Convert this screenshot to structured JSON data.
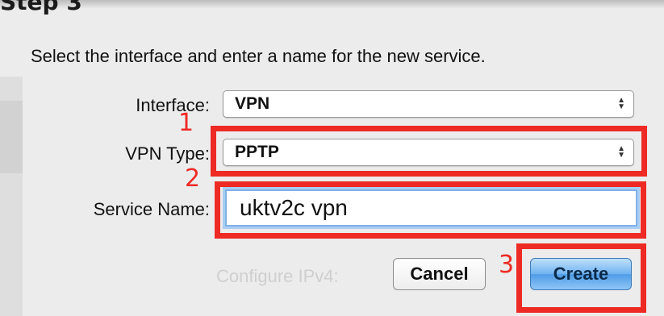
{
  "step_title": "Step 3",
  "instruction": "Select the interface and enter a name for the new service.",
  "interface": {
    "label": "Interface:",
    "value": "VPN"
  },
  "vpn_type": {
    "label": "VPN Type:",
    "value": "PPTP"
  },
  "service_name": {
    "label": "Service Name:",
    "value": "uktv2c vpn"
  },
  "buttons": {
    "cancel": "Cancel",
    "create": "Create"
  },
  "background_ghost_text": {
    "configure_ipv4": "Configure IPv4:"
  },
  "annotations": {
    "marker_1": "1",
    "marker_2": "2",
    "marker_3": "3",
    "color": "#ee2a24"
  },
  "icons": {
    "popup_arrows": "up-down-chevron-icon"
  }
}
